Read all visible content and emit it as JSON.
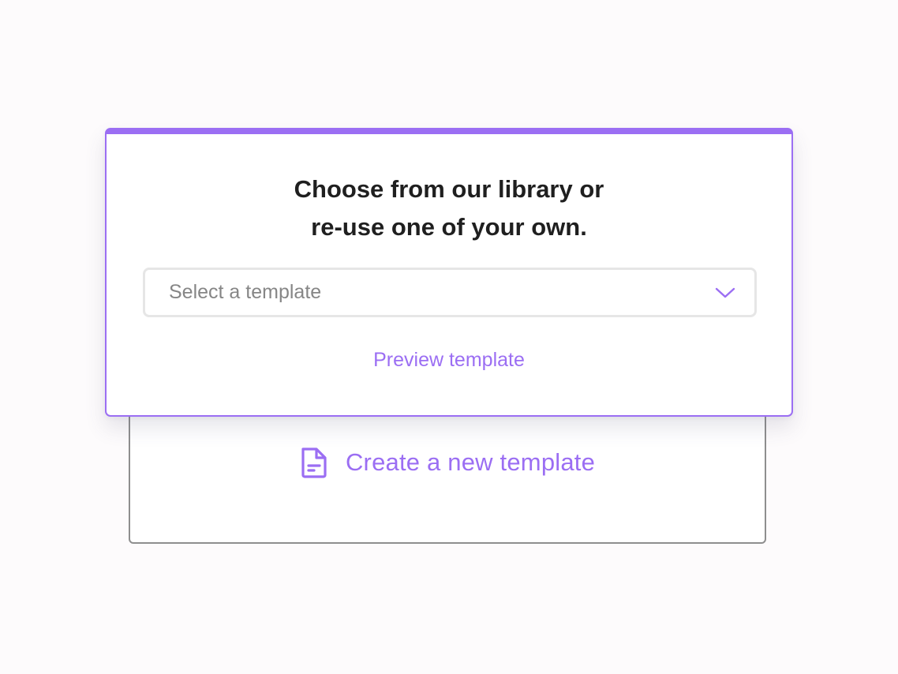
{
  "colors": {
    "accent": "#9b6ef3",
    "background": "#fdfbfc",
    "heading_text": "#1f1f1f",
    "placeholder_text": "#868686",
    "back_card_border": "#8e8e8e",
    "select_border": "#e6e6e6"
  },
  "modal": {
    "heading_line1": "Choose from our library or",
    "heading_line2": "re-use one of your own.",
    "select": {
      "placeholder": "Select a template",
      "icon": "chevron-down-icon"
    },
    "preview_link": "Preview template"
  },
  "create_card": {
    "label": "Create a new template",
    "icon": "document-icon"
  }
}
